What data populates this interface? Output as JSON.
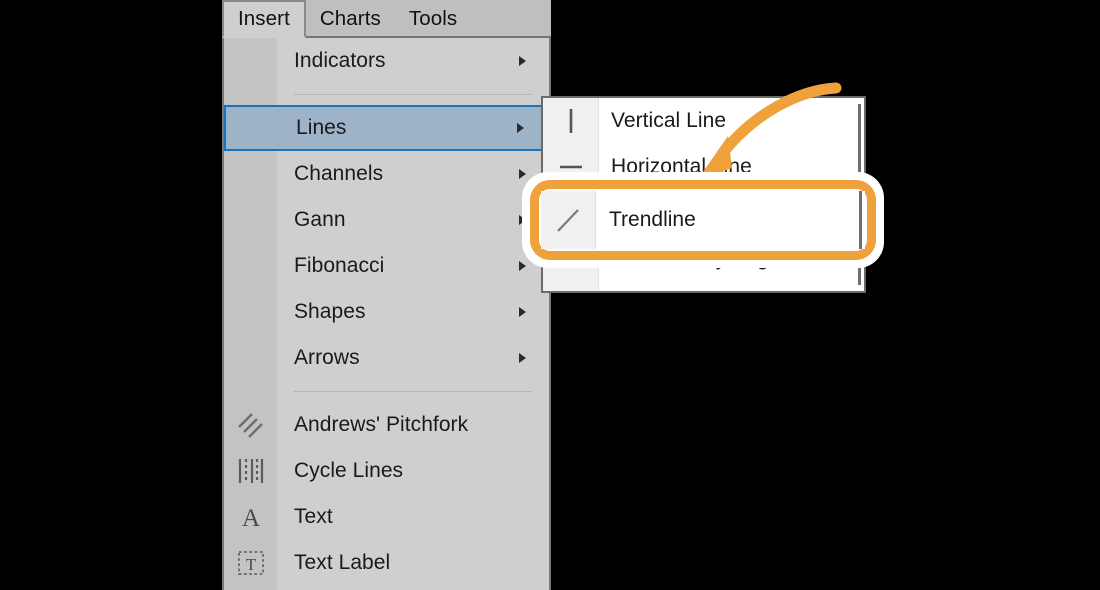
{
  "menubar": {
    "tabs": [
      {
        "label": "Insert",
        "active": true
      },
      {
        "label": "Charts",
        "active": false
      },
      {
        "label": "Tools",
        "active": false
      }
    ]
  },
  "insert_menu": {
    "items": [
      {
        "label": "Indicators",
        "icon": "none",
        "submenu": true,
        "selected": false
      },
      {
        "separator": true
      },
      {
        "label": "Lines",
        "icon": "none",
        "submenu": true,
        "selected": true
      },
      {
        "label": "Channels",
        "icon": "none",
        "submenu": true,
        "selected": false
      },
      {
        "label": "Gann",
        "icon": "none",
        "submenu": true,
        "selected": false
      },
      {
        "label": "Fibonacci",
        "icon": "none",
        "submenu": true,
        "selected": false
      },
      {
        "label": "Shapes",
        "icon": "none",
        "submenu": true,
        "selected": false
      },
      {
        "label": "Arrows",
        "icon": "none",
        "submenu": true,
        "selected": false
      },
      {
        "separator": true
      },
      {
        "label": "Andrews' Pitchfork",
        "icon": "pitchfork-icon",
        "submenu": false,
        "selected": false
      },
      {
        "label": "Cycle Lines",
        "icon": "cycle-lines-icon",
        "submenu": false,
        "selected": false
      },
      {
        "label": "Text",
        "icon": "text-a-icon",
        "submenu": false,
        "selected": false
      },
      {
        "label": "Text Label",
        "icon": "text-label-icon",
        "submenu": false,
        "selected": false
      }
    ]
  },
  "lines_submenu": {
    "items": [
      {
        "label": "Vertical Line",
        "icon": "vertical-line-icon"
      },
      {
        "label": "Horizontal Line",
        "icon": "horizontal-line-icon"
      },
      {
        "label": "Trendline",
        "icon": "trendline-icon"
      },
      {
        "label": "Trendline by Angle",
        "icon": "trendline-by-angle-icon"
      }
    ]
  },
  "annotation": {
    "highlight_target": "Trendline",
    "highlight_color": "#efa13c",
    "arrow_color": "#efa13c",
    "arrow_direction": "down-left"
  },
  "colors": {
    "menu_background": "#cfcfcf",
    "menu_gutter": "#c3c3c3",
    "menubar_background": "#bfbfbf",
    "selected_item": "#9db3c8",
    "selected_item_border": "#1e72b8",
    "submenu_background": "#ffffff",
    "submenu_gutter": "#f0f0f0",
    "page_background": "#000000",
    "text": "#1a1a1a"
  }
}
